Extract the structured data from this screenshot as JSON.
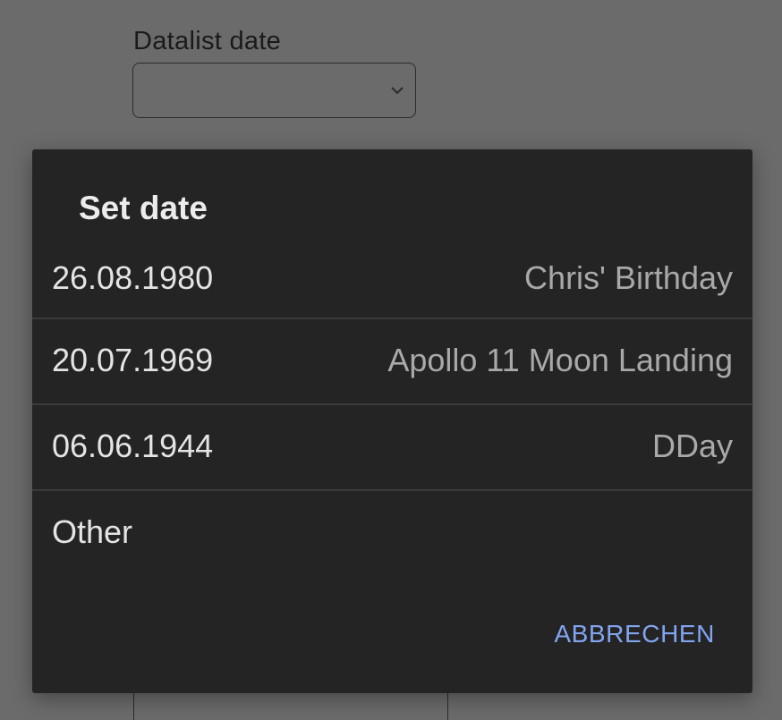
{
  "field": {
    "label": "Datalist date",
    "value": ""
  },
  "dialog": {
    "title": "Set date",
    "options": [
      {
        "date": "26.08.1980",
        "description": "Chris' Birthday"
      },
      {
        "date": "20.07.1969",
        "description": "Apollo 11 Moon Landing"
      },
      {
        "date": "06.06.1944",
        "description": "DDay"
      },
      {
        "date": "Other",
        "description": ""
      }
    ],
    "cancel_label": "ABBRECHEN"
  },
  "colors": {
    "overlay": "#6b6b6b",
    "dialog_bg": "#242424",
    "accent": "#82a5f0"
  }
}
